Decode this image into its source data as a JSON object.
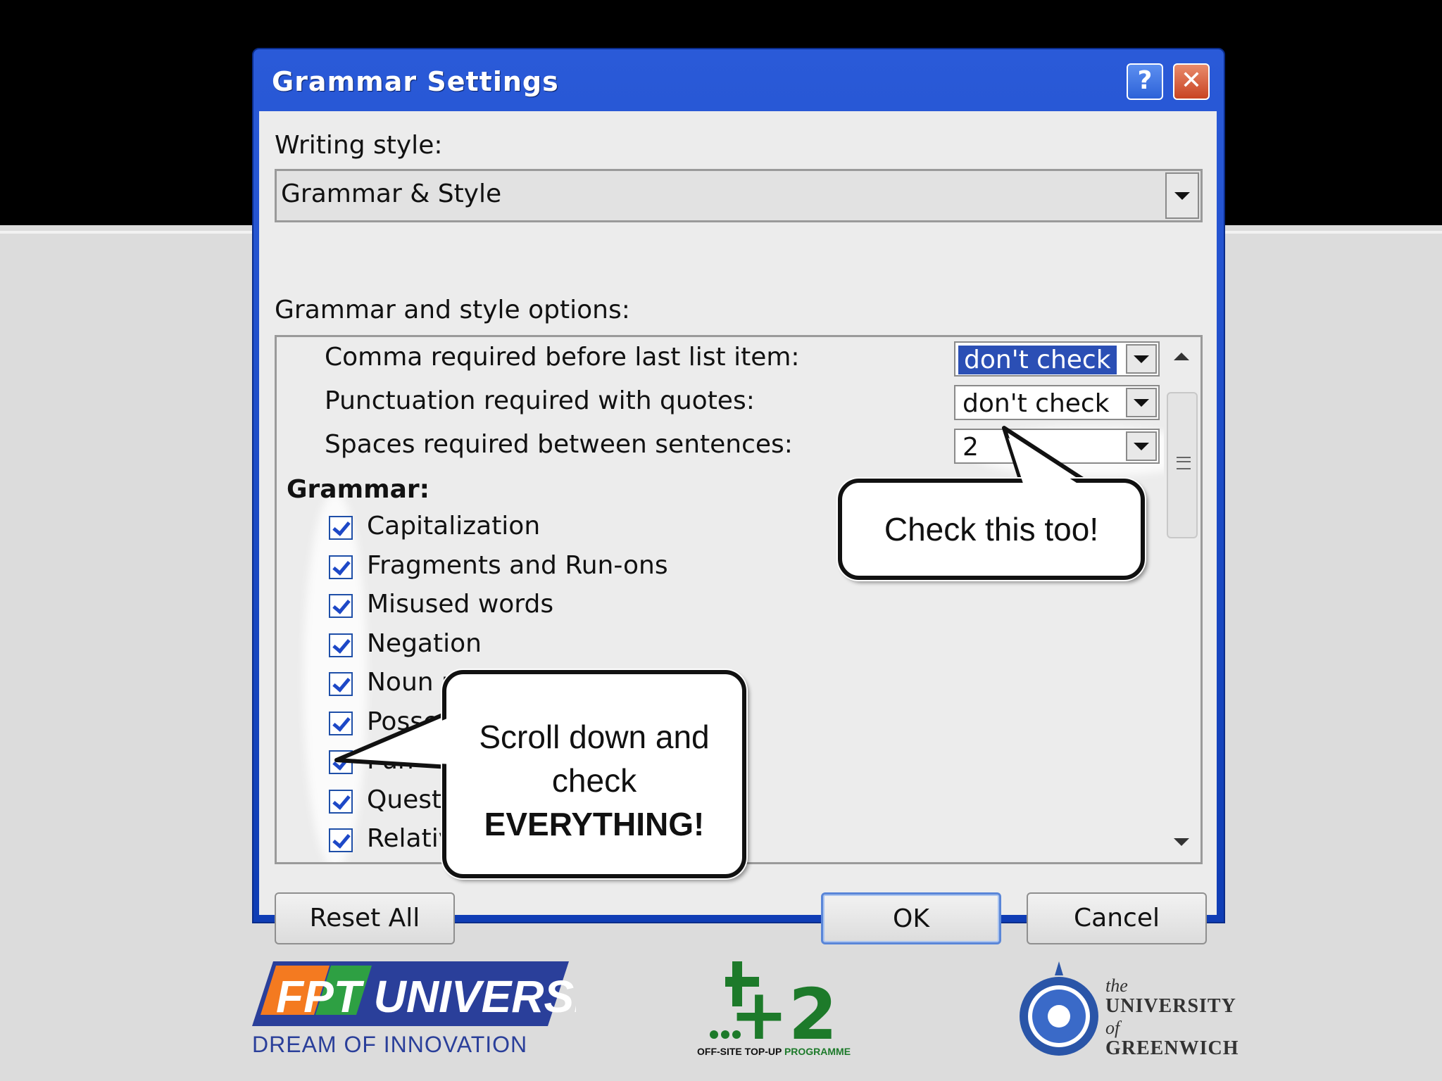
{
  "window": {
    "title": "Grammar Settings",
    "help_glyph": "?",
    "close_glyph": "✕"
  },
  "writing_style": {
    "label": "Writing style:",
    "value": "Grammar & Style"
  },
  "options": {
    "label": "Grammar and style options:",
    "require_rows": [
      {
        "label": "Comma required before last list item:",
        "value": "don't check",
        "selected": true
      },
      {
        "label": "Punctuation required with quotes:",
        "value": "don't check",
        "selected": false
      },
      {
        "label": "Spaces required between sentences:",
        "value": "2",
        "selected": false
      }
    ],
    "grammar_header": "Grammar:",
    "grammar_items": [
      {
        "label": "Capitalization",
        "checked": true
      },
      {
        "label": "Fragments and Run-ons",
        "checked": true
      },
      {
        "label": "Misused words",
        "checked": true
      },
      {
        "label": "Negation",
        "checked": true
      },
      {
        "label": "Noun phrases",
        "checked": true
      },
      {
        "label": "Posses",
        "checked": true
      },
      {
        "label": "Pun",
        "checked": true
      },
      {
        "label": "Questi",
        "checked": true
      },
      {
        "label": "Relativ",
        "checked": true
      }
    ]
  },
  "buttons": {
    "reset": "Reset All",
    "ok": "OK",
    "cancel": "Cancel"
  },
  "callouts": {
    "spaces": "Check this too!",
    "scroll_line1": "Scroll down and",
    "scroll_line2": "check",
    "scroll_line3": "EVERYTHING!"
  },
  "footer": {
    "fpt_logo_text": "FPT UNIVERSITY",
    "fpt_tagline": "DREAM OF INNOVATION",
    "plus2_logo_text": "+2",
    "plus2_tag_a": "OFF-SITE TOP-UP ",
    "plus2_tag_b": "PROGRAMME",
    "greenwich_the": "the",
    "greenwich_university": "UNIVERSITY",
    "greenwich_of": "of",
    "greenwich_name": "GREENWICH"
  },
  "colors": {
    "titlebar": "#1f4fc8",
    "selection": "#2b4fb5",
    "checkmark": "#1d48c7"
  }
}
